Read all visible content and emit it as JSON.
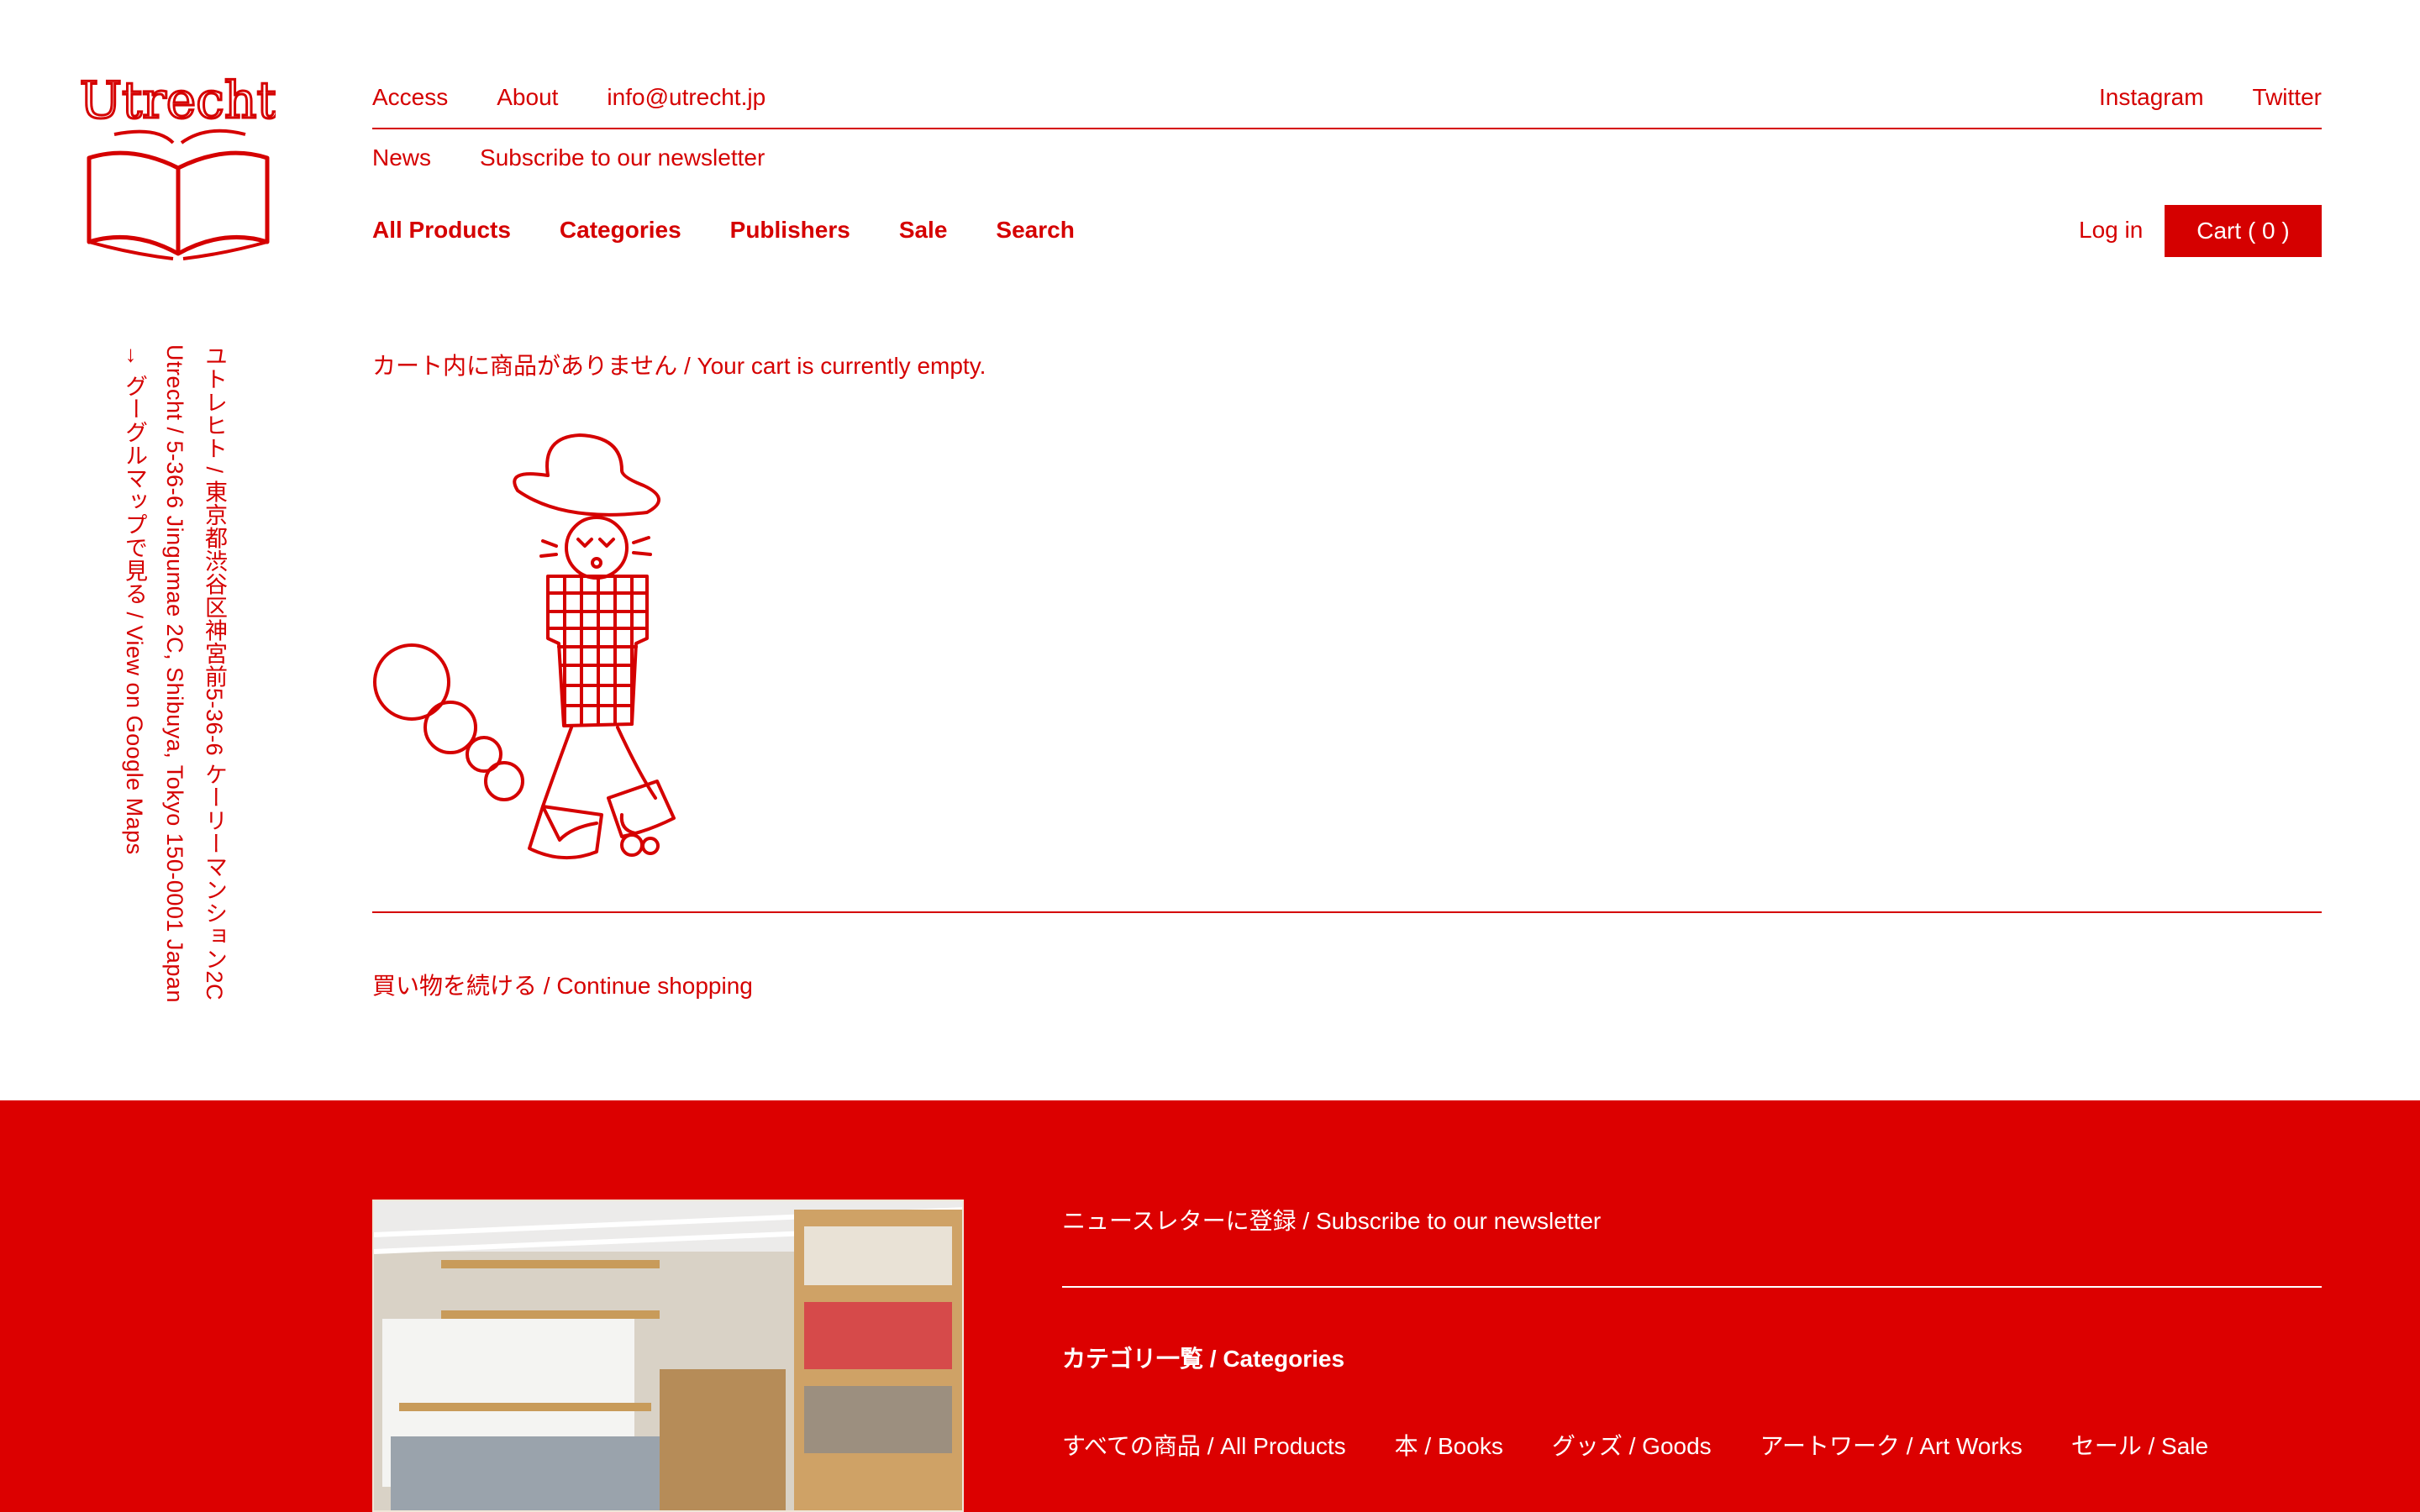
{
  "logo": {
    "text": "Utrecht"
  },
  "address": {
    "line_ja": "ユトレヒト / 東京都渋谷区神宮前5-36-6 ケーリーマンション2C",
    "line_en": "Utrecht / 5-36-6 Jingumae 2C, Shibuya, Tokyo 150-0001 Japan",
    "map_link": "→ グーグルマップで見る / View on Google Maps"
  },
  "header": {
    "top_left": [
      "Access",
      "About",
      "info@utrecht.jp"
    ],
    "top_right": [
      "Instagram",
      "Twitter"
    ],
    "sub": [
      "News",
      "Subscribe to our newsletter"
    ],
    "main": [
      "All Products",
      "Categories",
      "Publishers",
      "Sale",
      "Search"
    ],
    "login": "Log in",
    "cart": "Cart ( 0 )"
  },
  "main": {
    "empty_message": "カート内に商品がありません / Your cart is currently empty.",
    "continue": "買い物を続ける / Continue shopping"
  },
  "footer": {
    "newsletter": "ニュースレターに登録 / Subscribe to our newsletter",
    "categories_title": "カテゴリ一覧 / Categories",
    "categories": [
      "すべての商品 / All Products",
      "本 / Books",
      "グッズ / Goods",
      "アートワーク / Art Works",
      "セール / Sale"
    ]
  },
  "colors": {
    "brand_red": "#d50000",
    "footer_red": "#dc0000",
    "background": "#ffffff"
  },
  "icons": {
    "logo": "utrecht-book-logo",
    "illustration": "walking-person-drawing"
  }
}
